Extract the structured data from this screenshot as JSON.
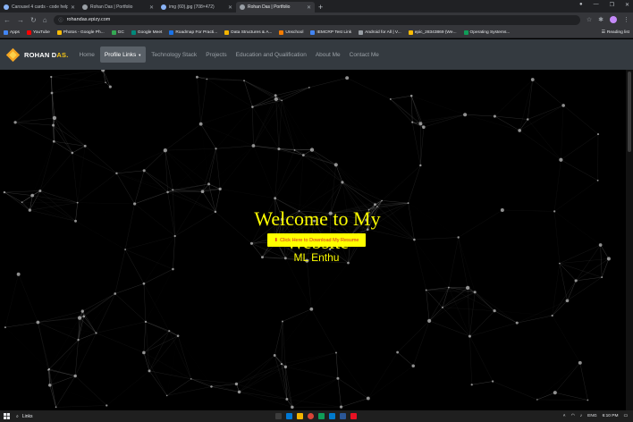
{
  "browser": {
    "tabs": [
      {
        "title": "Carousel 4 cards - code helper",
        "color": "#8ab4f8"
      },
      {
        "title": "Rohan Das | Portfolio",
        "color": "#9aa0a6"
      },
      {
        "title": "img (60).jpg (708×472)",
        "color": "#8ab4f8"
      },
      {
        "title": "Rohan Das | Portfolio",
        "color": "#9aa0a6"
      }
    ],
    "url": "rohandas.epizy.com",
    "bookmarks": [
      {
        "label": "Apps",
        "color": "#4285f4"
      },
      {
        "label": "YouTube",
        "color": "#ff0000"
      },
      {
        "label": "Photos - Google Ph...",
        "color": "#fbbc05"
      },
      {
        "label": "GC",
        "color": "#34a853"
      },
      {
        "label": "Google Meet",
        "color": "#00897b"
      },
      {
        "label": "Roadmap For Practi...",
        "color": "#1a73e8"
      },
      {
        "label": "Data Structures & A...",
        "color": "#f4b400"
      },
      {
        "label": "Unschool",
        "color": "#f57c00"
      },
      {
        "label": "IEMCRP Test Link",
        "color": "#4285f4"
      },
      {
        "label": "Android for All | V...",
        "color": "#9aa0a6"
      },
      {
        "label": "epic_28343869 (We...",
        "color": "#fbbc05"
      },
      {
        "label": "Operating Systems...",
        "color": "#0f9d58"
      }
    ],
    "reading_list": "Reading list"
  },
  "navbar": {
    "brand_first": "ROHAN D",
    "brand_accent": "AS.",
    "links": [
      "Home",
      "Profile Links",
      "Technology Stack",
      "Projects",
      "Education and Qualification",
      "About Me",
      "Contact Me"
    ]
  },
  "hero": {
    "title": "Welcome to My Website",
    "resume_button": "Click Here to Download My Resume",
    "tagline": "ML Enthu"
  },
  "taskbar": {
    "search_text": "Links",
    "time": "6:10 PM",
    "lang": "ENG"
  },
  "colors": {
    "accent": "#ffff00",
    "navbar": "#343a40",
    "brand_accent": "#f5c518"
  }
}
